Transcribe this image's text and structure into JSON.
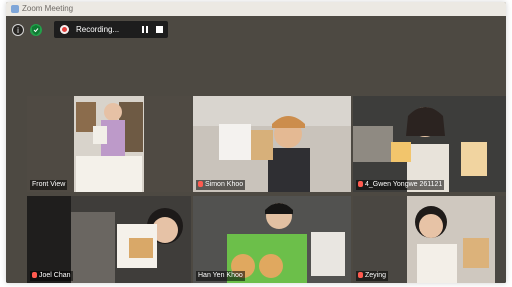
{
  "window": {
    "title": "Zoom Meeting"
  },
  "toolbar": {
    "info_icon": "info-icon",
    "security_icon": "shield-check-icon",
    "recording_label": "Recording...",
    "pause_icon": "pause-icon",
    "stop_icon": "stop-icon"
  },
  "gallery": {
    "tiles": [
      {
        "name": "Front View",
        "muted": false,
        "active": true
      },
      {
        "name": "Simon Khoo",
        "muted": true,
        "active": false
      },
      {
        "name": "4_Gwen Yongwe 261121",
        "muted": true,
        "active": false
      },
      {
        "name": "Joel Chan",
        "muted": true,
        "active": false
      },
      {
        "name": "Han Yen Khoo",
        "muted": false,
        "active": false
      },
      {
        "name": "Zeying",
        "muted": true,
        "active": false
      }
    ]
  },
  "colors": {
    "background": "#4d4942",
    "active_speaker_border": "#d8d56a",
    "recording_dot": "#e43e3b",
    "security_green": "#22a14a",
    "muted_red": "#ff5a4f"
  }
}
